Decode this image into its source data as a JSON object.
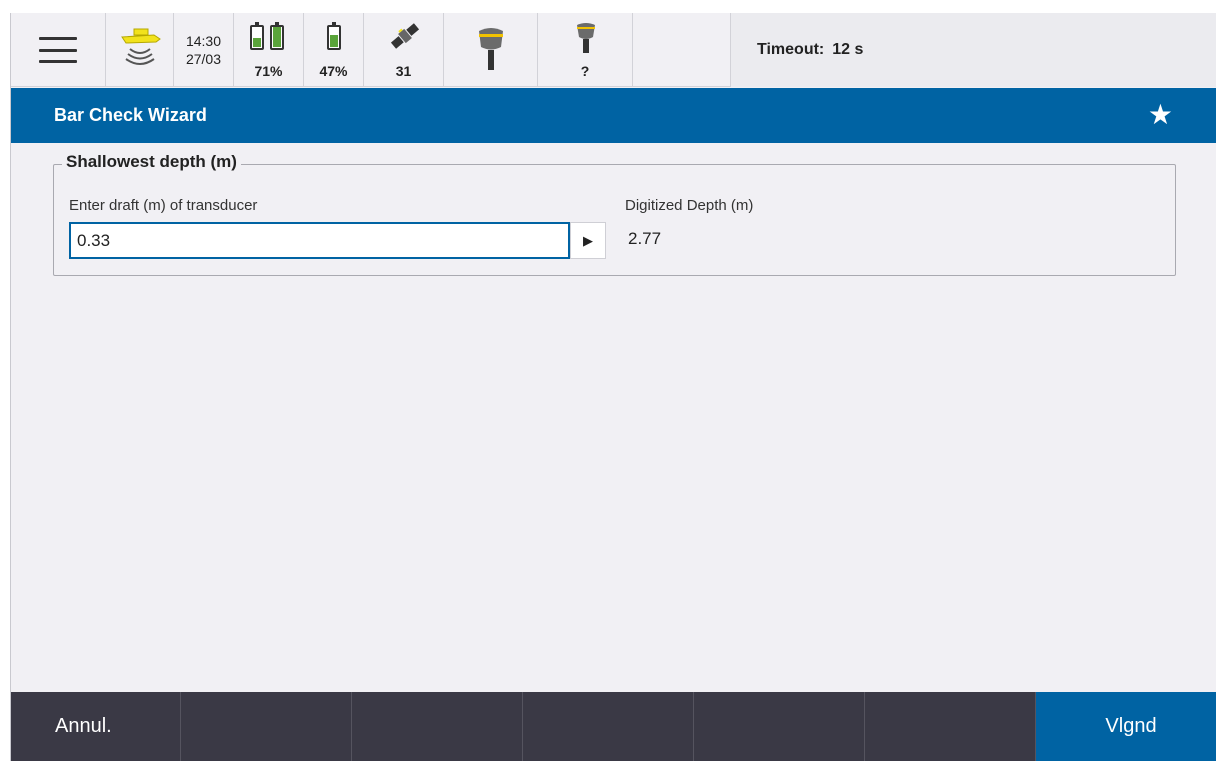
{
  "status_bar": {
    "menu_icon": "hamburger-menu-icon",
    "sonar_icon": "echosounder-icon",
    "time": "14:30",
    "date": "27/03",
    "battery_1_percent": "71%",
    "battery_1_levels": [
      0.45,
      0.95
    ],
    "battery_2_percent": "47%",
    "battery_2_level": 0.55,
    "satellites_count": "31",
    "satellite_icon": "satellite-icon",
    "receiver_1_icon": "gnss-receiver-icon",
    "receiver_2_label": "?",
    "receiver_2_icon": "gnss-receiver-icon",
    "timeout_label": "Timeout:",
    "timeout_value": "12 s"
  },
  "title_bar": {
    "title": "Bar Check Wizard",
    "favorite_icon": "star-icon"
  },
  "form": {
    "group_title": "Shallowest depth (m)",
    "draft_label": "Enter draft (m) of transducer",
    "draft_value": "0.33",
    "digitized_label": "Digitized Depth (m)",
    "digitized_value": "2.77"
  },
  "bottom_bar": {
    "cancel_label": "Annul.",
    "next_label": "Vlgnd"
  },
  "colors": {
    "accent": "#0063a3",
    "bottom_bar": "#3a3945",
    "battery_fill": "#5aa43a",
    "sonar_yellow": "#f2e21c"
  }
}
